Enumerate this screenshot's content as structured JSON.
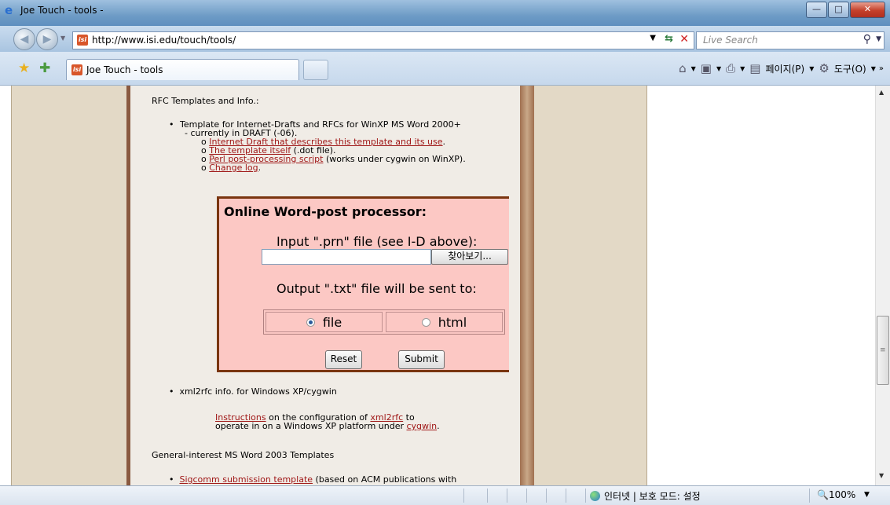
{
  "window": {
    "title": "Joe Touch - tools -"
  },
  "address_bar": {
    "url": "http://www.isi.edu/touch/tools/",
    "search_placeholder": "Live Search"
  },
  "tab": {
    "label": "Joe Touch - tools"
  },
  "command_bar": {
    "page_menu": "페이지(P)",
    "tools_menu": "도구(O)"
  },
  "page": {
    "section_rfc": "RFC Templates and Info.:",
    "bullet1_line1": "Template for Internet-Drafts and RFCs for WinXP MS Word 2000+",
    "bullet1_line2": "- currently in DRAFT (-06).",
    "sub1_link": "Internet Draft that describes this template and its use",
    "sub1_tail": ".",
    "sub2_link": "The template itself",
    "sub2_tail": " (.dot file).",
    "sub3_link": "Perl post-processing script",
    "sub3_tail": " (works under cygwin on WinXP).",
    "sub4_link": "Change log",
    "sub4_tail": ".",
    "form": {
      "title": "Online Word-post processor:",
      "input_label": "Input \".prn\" file (see I-D above):",
      "browse_button": "찾아보기...",
      "output_label": "Output \".txt\" file will be sent to:",
      "option_file": "file",
      "option_html": "html",
      "selected": "file",
      "reset_button": "Reset",
      "submit_button": "Submit"
    },
    "bullet2": "xml2rfc info. for Windows XP/cygwin",
    "instr_link1": "Instructions",
    "instr_text1": " on the configuration of ",
    "instr_link2": "xml2rfc",
    "instr_text2": " to",
    "instr_line2": "operate in on a Windows XP platform under ",
    "instr_link3": "cygwin",
    "instr_tail": ".",
    "section_word": "General-interest MS Word 2003 Templates",
    "bullet3_link": "Sigcomm submission template",
    "bullet3_tail": " (based on ACM publications with"
  },
  "status_bar": {
    "zone": "인터넷 | 보호 모드: 설정",
    "zoom": "100%"
  }
}
